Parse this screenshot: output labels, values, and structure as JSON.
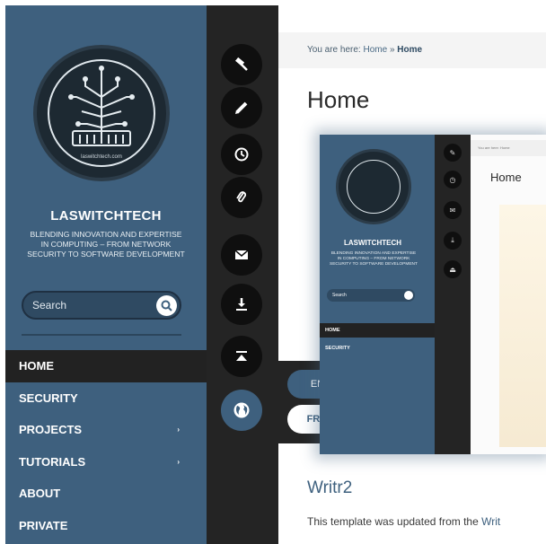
{
  "site": {
    "name": "LASWITCHTECH",
    "tagline": "Blending innovation and expertise in computing – from network security to software development",
    "logo_caption": "laswitchtech.com"
  },
  "search": {
    "placeholder": "Search"
  },
  "nav": {
    "items": [
      {
        "label": "HOME",
        "active": true,
        "has_submenu": false
      },
      {
        "label": "SECURITY",
        "has_submenu": false
      },
      {
        "label": "PROJECTS",
        "has_submenu": true
      },
      {
        "label": "TUTORIALS",
        "has_submenu": true
      },
      {
        "label": "ABOUT",
        "has_submenu": false
      },
      {
        "label": "PRIVATE",
        "has_submenu": false
      }
    ],
    "submenu_arrow": "›"
  },
  "rail_icons": [
    "hammer-icon",
    "pencil-icon",
    "clock-icon",
    "paperclip-icon",
    "envelope-icon",
    "download-icon",
    "eject-icon",
    "globe-icon"
  ],
  "language": {
    "english": "ENGLISH",
    "french": "FRANÇAIS",
    "selected": "FRANÇAIS"
  },
  "breadcrumb": {
    "prefix": "You are here:",
    "link": "Home",
    "separator": "»",
    "current": "Home"
  },
  "page": {
    "title": "Home",
    "section_title": "Writr2",
    "body_prefix": "This template was updated from the ",
    "body_link": "Writ"
  },
  "thumbnail": {
    "brand": "LASWITCHTECH",
    "tagline": "Blending innovation and expertise in computing – from network security to software development",
    "search_placeholder": "Search",
    "nav": [
      "HOME",
      "SECURITY"
    ],
    "title": "Home",
    "breadcrumb": "You are here: Home"
  },
  "colors": {
    "sidebar": "#3e607e",
    "rail": "#242424",
    "accent": "#3e607e"
  }
}
